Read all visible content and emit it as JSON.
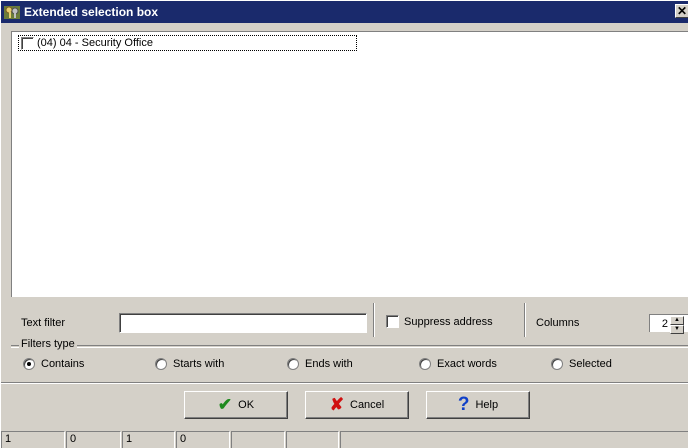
{
  "window": {
    "title": "Extended selection box",
    "close_glyph": "✕",
    "icon": "keys-app-icon"
  },
  "list": {
    "items": [
      {
        "label": "(04) 04 - Security Office",
        "checked": false
      }
    ]
  },
  "filter": {
    "text_filter_label": "Text filter",
    "text_filter_value": "",
    "suppress_address_label": "Suppress address",
    "suppress_address_checked": false,
    "columns_label": "Columns",
    "columns_value": "2"
  },
  "filters_type": {
    "label": "Filters type",
    "options": [
      {
        "label": "Contains",
        "selected": true
      },
      {
        "label": "Starts with",
        "selected": false
      },
      {
        "label": "Ends with",
        "selected": false
      },
      {
        "label": "Exact words",
        "selected": false
      },
      {
        "label": "Selected",
        "selected": false
      }
    ]
  },
  "buttons": {
    "ok_label": "OK",
    "cancel_label": "Cancel",
    "help_label": "Help",
    "ok_icon": "checkmark-icon",
    "cancel_icon": "x-icon",
    "help_icon": "question-icon"
  },
  "statusbar": {
    "cells": [
      "1",
      "0",
      "1",
      "0",
      "",
      "",
      ""
    ]
  },
  "colors": {
    "titlebar": "#1a2a6c",
    "face": "#d4d0c8",
    "ok_icon": "#1f8a1f",
    "cancel_icon": "#d01010",
    "help_icon": "#1040c8"
  }
}
